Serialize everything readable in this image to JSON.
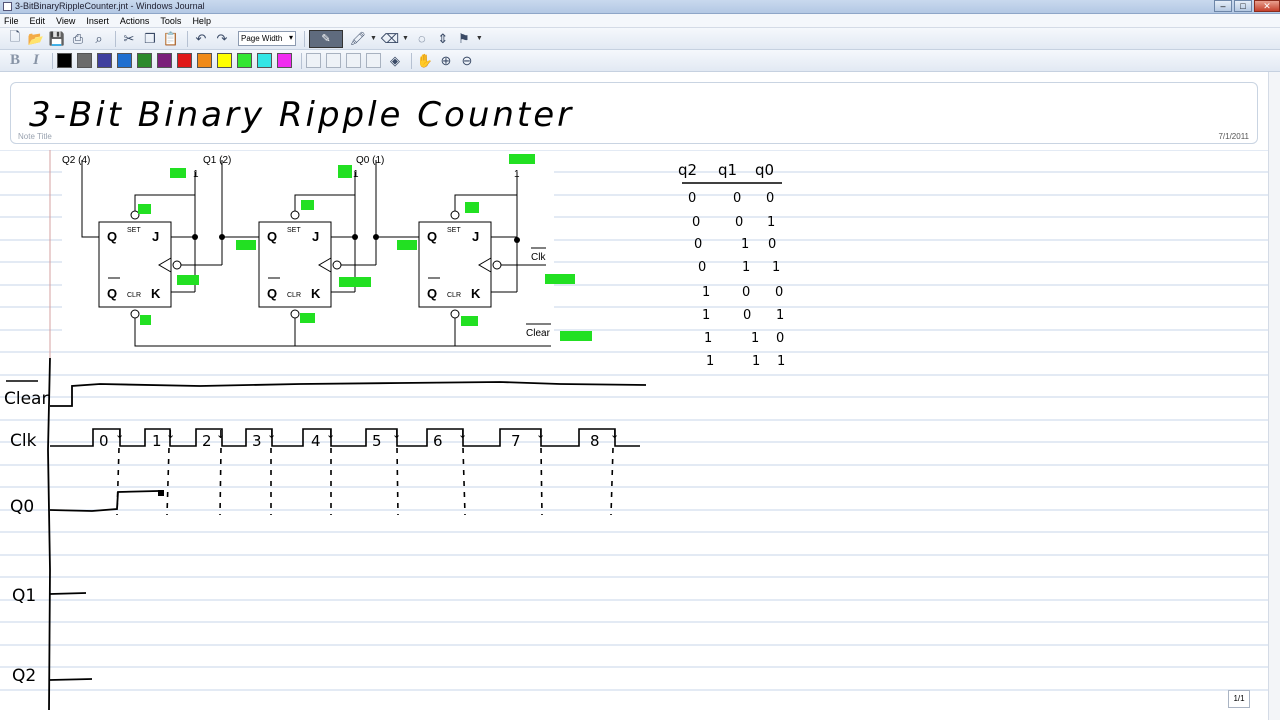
{
  "window": {
    "title": "3-BitBinaryRippleCounter.jnt - Windows Journal",
    "min": "–",
    "max": "□",
    "close": "✕"
  },
  "menu": [
    "File",
    "Edit",
    "View",
    "Insert",
    "Actions",
    "Tools",
    "Help"
  ],
  "toolbar": {
    "zoom_value": "Page Width",
    "zoom_arrow": "▾",
    "bold": "B",
    "italic": "I"
  },
  "colors": [
    "#000000",
    "#6b6b6b",
    "#3f3f9f",
    "#1f6fd0",
    "#2c8a2c",
    "#7a1f7a",
    "#e01818",
    "#f08a18",
    "#ffff00",
    "#33e633",
    "#33e6e6",
    "#f02cf0"
  ],
  "note": {
    "title": "3-Bit Binary Ripple Counter",
    "title_hint": "Note Title",
    "date": "7/1/2011",
    "page": "1/1"
  },
  "circuit": {
    "labels": [
      "Q2 (4)",
      "Q1 (2)",
      "Q0 (1)",
      "1",
      "1",
      "1",
      "Clk",
      "Clear"
    ],
    "ff_pins": [
      "Q",
      "SET",
      "J",
      "Q",
      "CLR",
      "K"
    ]
  },
  "truth_table": {
    "headers": [
      "q2",
      "q1",
      "q0"
    ],
    "rows": [
      [
        "0",
        "0",
        "0"
      ],
      [
        "0",
        "0",
        "1"
      ],
      [
        "0",
        "1",
        "0"
      ],
      [
        "0",
        "1",
        "1"
      ],
      [
        "1",
        "0",
        "0"
      ],
      [
        "1",
        "0",
        "1"
      ],
      [
        "1",
        "1",
        "0"
      ],
      [
        "1",
        "1",
        "1"
      ]
    ]
  },
  "timing": {
    "signals": [
      "Clear",
      "Clk",
      "Q0",
      "Q1",
      "Q2"
    ],
    "pulse_labels": [
      "0",
      "1",
      "2",
      "3",
      "4",
      "5",
      "6",
      "7",
      "8"
    ]
  }
}
